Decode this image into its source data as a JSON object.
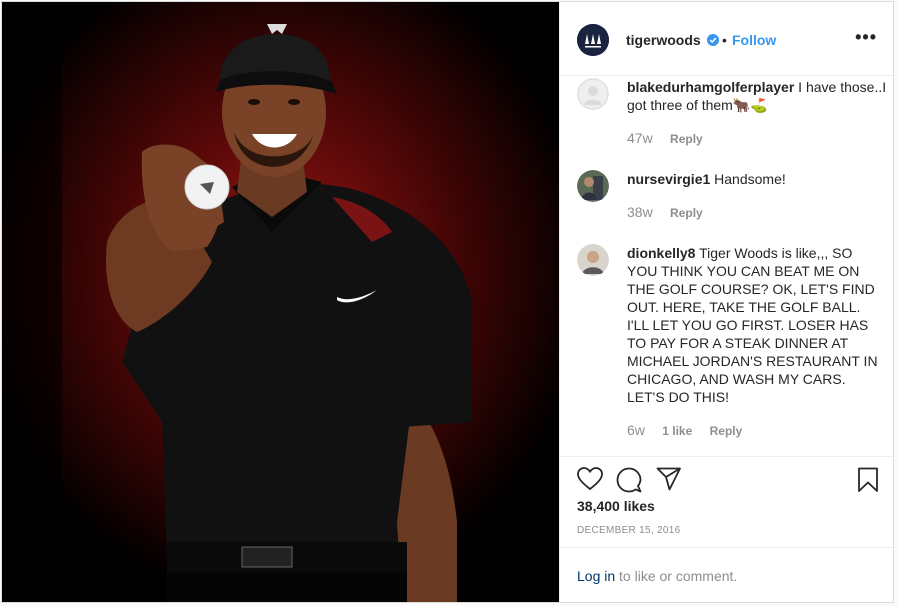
{
  "post": {
    "username": "tigerwoods",
    "separator": "•",
    "follow_label": "Follow",
    "more_label": "•••",
    "likes": "38,400 likes",
    "date": "DECEMBER 15, 2016"
  },
  "comments": [
    {
      "username": "blakedurhamgolferplayer",
      "text": "I have those..I got three of them🐂⛳️",
      "age": "47w",
      "likes_label": "",
      "reply_label": "Reply"
    },
    {
      "username": "nursevirgie1",
      "text": "Handsome!",
      "age": "38w",
      "likes_label": "",
      "reply_label": "Reply"
    },
    {
      "username": "dionkelly8",
      "text": "Tiger Woods is like,,, SO YOU THINK YOU CAN BEAT ME ON THE GOLF COURSE? OK, LET'S FIND OUT. HERE, TAKE THE GOLF BALL. I'LL LET YOU GO FIRST. LOSER HAS TO PAY FOR A STEAK DINNER AT MICHAEL JORDAN'S RESTAURANT IN CHICAGO, AND WASH MY CARS. LET'S DO THIS!",
      "age": "6w",
      "likes_label": "1 like",
      "reply_label": "Reply"
    }
  ],
  "login": {
    "link_label": "Log in",
    "suffix": " to like or comment."
  },
  "icons": {
    "like": "heart-icon",
    "comment": "comment-icon",
    "share": "share-icon",
    "save": "bookmark-icon",
    "verified": "verified-badge-icon"
  },
  "colors": {
    "accent": "#3897f0",
    "text": "#262626",
    "muted": "#8e8e8e",
    "link": "#00376b"
  }
}
